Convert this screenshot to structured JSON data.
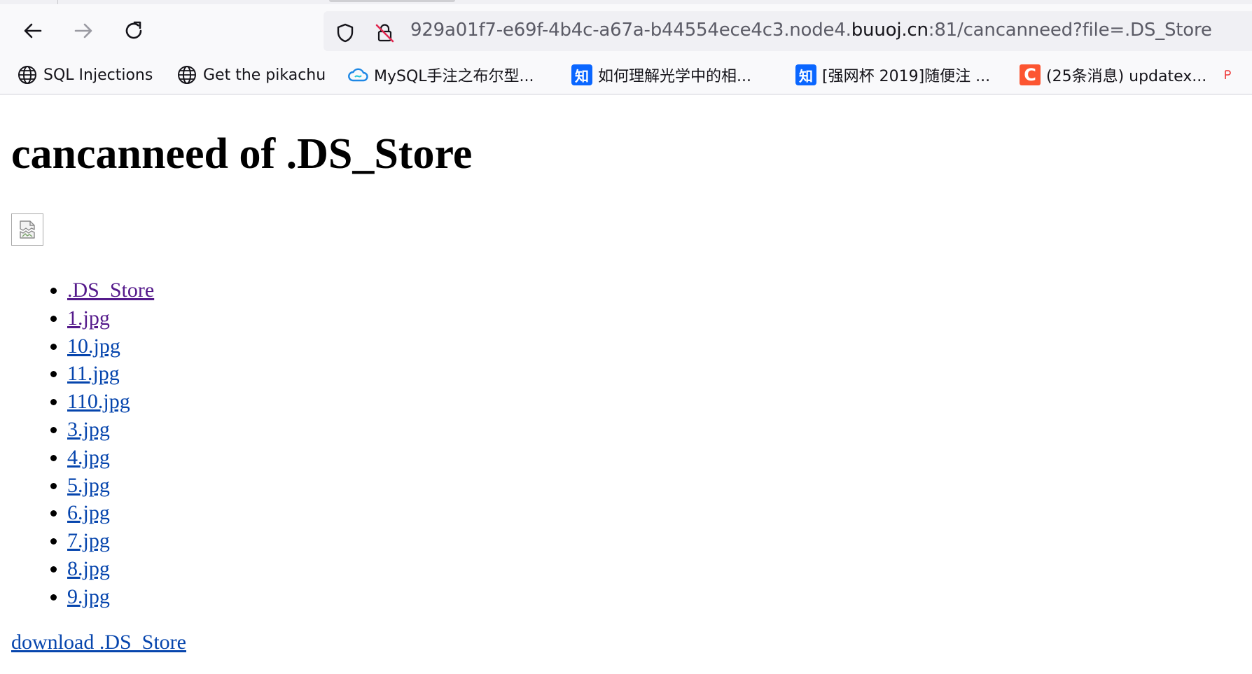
{
  "browser": {
    "url_prefix": "929a01f7-e69f-4b4c-a67a-b44554ece4c3.node4.",
    "url_host": "buuoj.cn",
    "url_suffix": ":81/cancanneed?file=.DS_Store",
    "icons": {
      "back": "arrow-left-icon",
      "forward": "arrow-right-icon",
      "reload": "reload-icon",
      "tracking": "shield-icon",
      "insecure": "insecure-lock-icon"
    },
    "bookmarks": [
      {
        "label": "SQL Injections",
        "icon": "globe-icon"
      },
      {
        "label": "Get the pikachu",
        "icon": "globe-icon"
      },
      {
        "label": "MySQL手注之布尔型...",
        "icon": "cloud-icon"
      },
      {
        "label": "如何理解光学中的相...",
        "icon": "zhihu-icon",
        "badge": "知"
      },
      {
        "label": "[强网杯 2019]随便注 ...",
        "icon": "zhihu-icon",
        "badge": "知"
      },
      {
        "label": "(25条消息) updatex...",
        "icon": "csdn-icon",
        "badge": "C"
      }
    ],
    "colors": {
      "zhihu": "#0a66ff",
      "csdn": "#fc5531",
      "link": "#0645ad",
      "visited": "#551a8b"
    }
  },
  "page": {
    "title": "cancanneed of .DS_Store",
    "image_icon": "broken-image-icon",
    "files": [
      {
        "name": ".DS_Store",
        "visited": true
      },
      {
        "name": "1.jpg",
        "visited": true
      },
      {
        "name": "10.jpg",
        "visited": false
      },
      {
        "name": "11.jpg",
        "visited": false
      },
      {
        "name": "110.jpg",
        "visited": false
      },
      {
        "name": "3.jpg",
        "visited": false
      },
      {
        "name": "4.jpg",
        "visited": false
      },
      {
        "name": "5.jpg",
        "visited": false
      },
      {
        "name": "6.jpg",
        "visited": false
      },
      {
        "name": "7.jpg",
        "visited": false
      },
      {
        "name": "8.jpg",
        "visited": false
      },
      {
        "name": "9.jpg",
        "visited": false
      }
    ],
    "download_label": "download .DS_Store"
  }
}
